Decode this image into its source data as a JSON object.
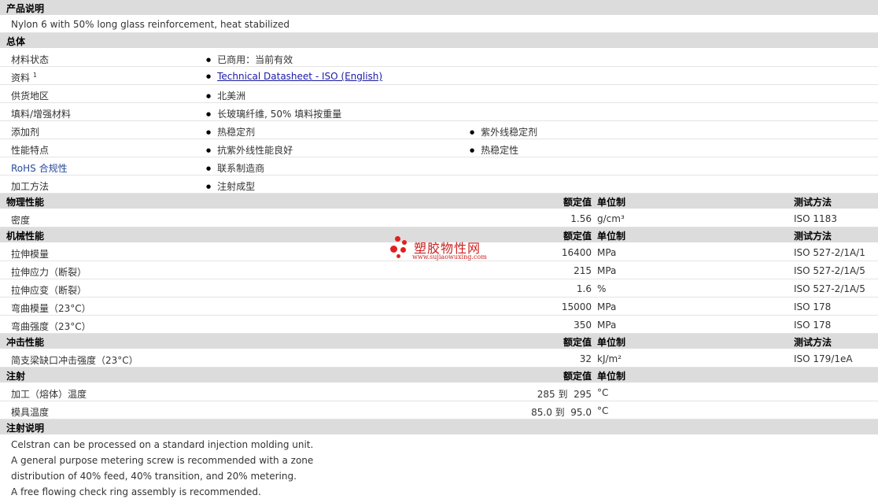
{
  "product": {
    "heading": "产品说明",
    "description": "Nylon 6 with 50% long glass reinforcement, heat stabilized"
  },
  "general": {
    "heading": "总体",
    "rows": [
      {
        "label": "材料状态",
        "values": [
          "已商用：当前有效"
        ]
      },
      {
        "label": "资料",
        "sup": "1",
        "link": "Technical Datasheet - ISO (English)"
      },
      {
        "label": "供货地区",
        "values": [
          "北美洲"
        ]
      },
      {
        "label": "填料/增强材料",
        "values": [
          "长玻璃纤维, 50% 填料按重量"
        ]
      },
      {
        "label": "添加剂",
        "values": [
          "热稳定剂",
          "紫外线稳定剂"
        ]
      },
      {
        "label": "性能特点",
        "values": [
          "抗紫外线性能良好",
          "热稳定性"
        ]
      },
      {
        "label": "RoHS 合规性",
        "values": [
          "联系制造商"
        ]
      },
      {
        "label": "加工方法",
        "values": [
          "注射成型"
        ]
      }
    ]
  },
  "columns": {
    "rated": "额定值",
    "unit": "单位制",
    "method": "测试方法"
  },
  "physical": {
    "heading": "物理性能",
    "rows": [
      {
        "label": "密度",
        "value": "1.56",
        "unit": "g/cm³",
        "method": "ISO 1183"
      }
    ]
  },
  "mechanical": {
    "heading": "机械性能",
    "rows": [
      {
        "label": "拉伸模量",
        "value": "16400",
        "unit": "MPa",
        "method": "ISO 527-2/1A/1"
      },
      {
        "label": "拉伸应力（断裂）",
        "value": "215",
        "unit": "MPa",
        "method": "ISO 527-2/1A/5"
      },
      {
        "label": "拉伸应变（断裂）",
        "value": "1.6",
        "unit": "%",
        "method": "ISO 527-2/1A/5"
      },
      {
        "label": "弯曲模量（23°C）",
        "value": "15000",
        "unit": "MPa",
        "method": "ISO 178"
      },
      {
        "label": "弯曲强度（23°C）",
        "value": "350",
        "unit": "MPa",
        "method": "ISO 178"
      }
    ]
  },
  "impact": {
    "heading": "冲击性能",
    "rows": [
      {
        "label": "简支梁缺口冲击强度（23°C）",
        "value": "32",
        "unit": "kJ/m²",
        "method": "ISO 179/1eA"
      }
    ]
  },
  "injection": {
    "heading": "注射",
    "rows": [
      {
        "label": "加工（熔体）温度",
        "value": "285 到  295",
        "unit": "°C"
      },
      {
        "label": "模具温度",
        "value": "85.0 到  95.0",
        "unit": "°C"
      }
    ]
  },
  "notes": {
    "heading": "注射说明",
    "lines": [
      "Celstran can be processed on a standard injection molding unit.",
      "A general purpose metering screw is recommended with a zone",
      "distribution of 40% feed, 40% transition, and 20% metering.",
      "A free flowing check ring assembly is recommended."
    ]
  },
  "watermark": {
    "name": "塑胶物性网",
    "url": "www.sujiaowuxing.com"
  }
}
